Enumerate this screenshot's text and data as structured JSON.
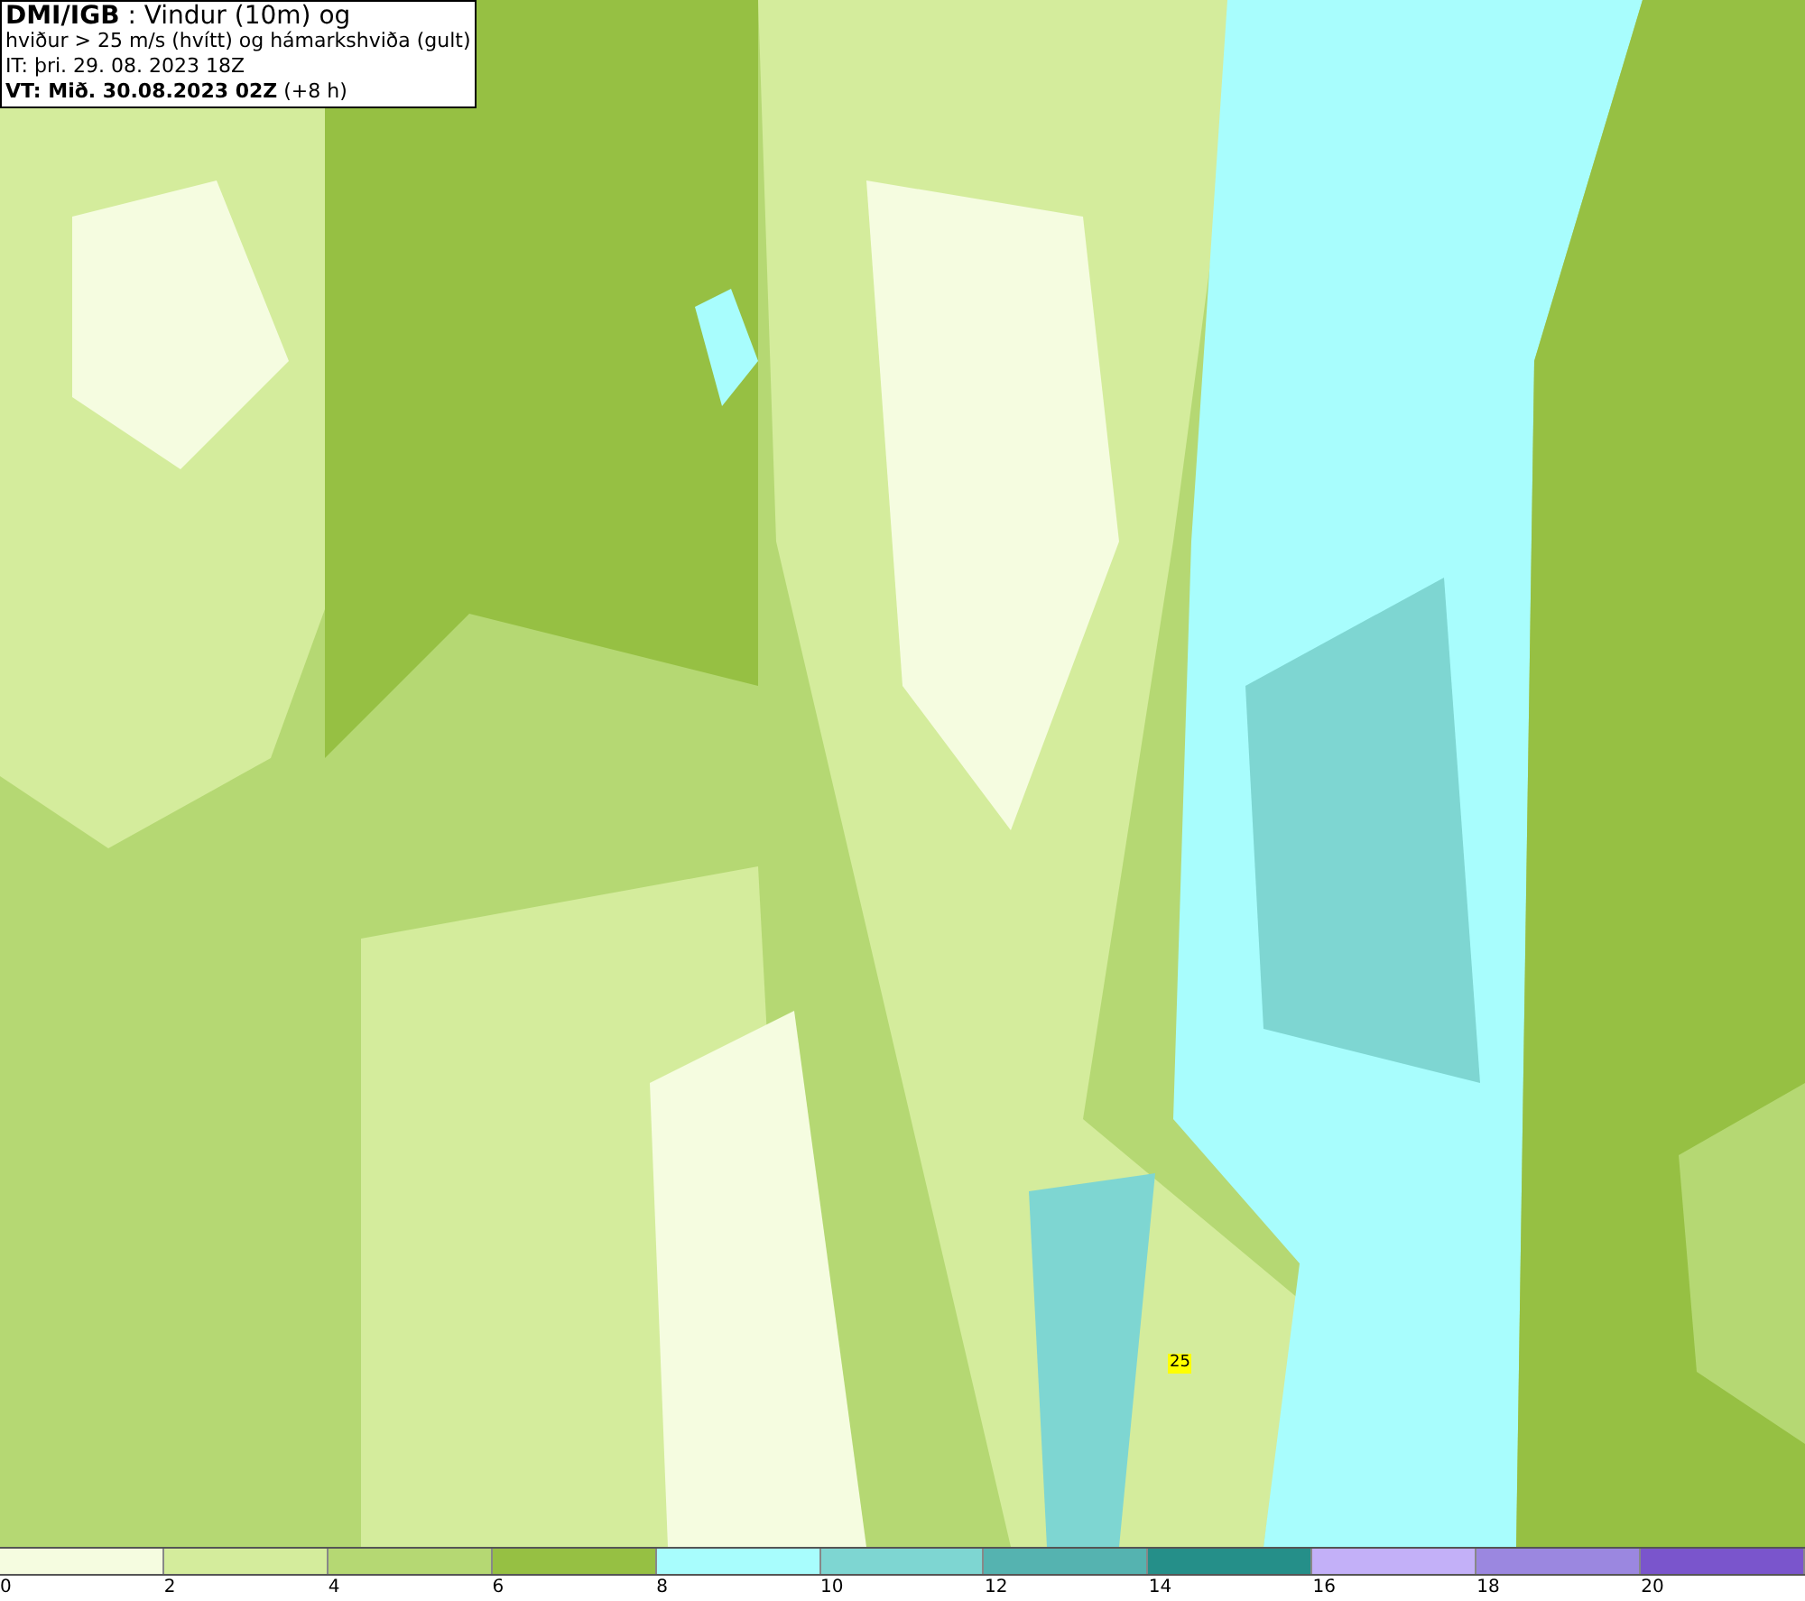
{
  "title_box": {
    "lines": [
      "**DMI/IGB** : Vindur (10m) og",
      "hviður > 25 m/s (hvítt) og hámarkshviða (gult)",
      "IT: þri. 29. 08. 2023 18Z",
      "**VT: Mið. 30.08.2023 02Z** (+8 h)"
    ]
  },
  "map": {
    "gust_marker": "25"
  },
  "legend": {
    "bins": [
      {
        "color": "#f5fce0"
      },
      {
        "color": "#d4ec9c"
      },
      {
        "color": "#b5d873"
      },
      {
        "color": "#96c043"
      },
      {
        "color": "#a8fdfd"
      },
      {
        "color": "#7ed6d2"
      },
      {
        "color": "#55b3b0"
      },
      {
        "color": "#258f89"
      },
      {
        "color": "#c3b0f8"
      },
      {
        "color": "#9b87e0"
      },
      {
        "color": "#7a55cc"
      }
    ],
    "labels": [
      "0",
      "2",
      "4",
      "6",
      "8",
      "10",
      "12",
      "14",
      "16",
      "18",
      "20"
    ]
  }
}
